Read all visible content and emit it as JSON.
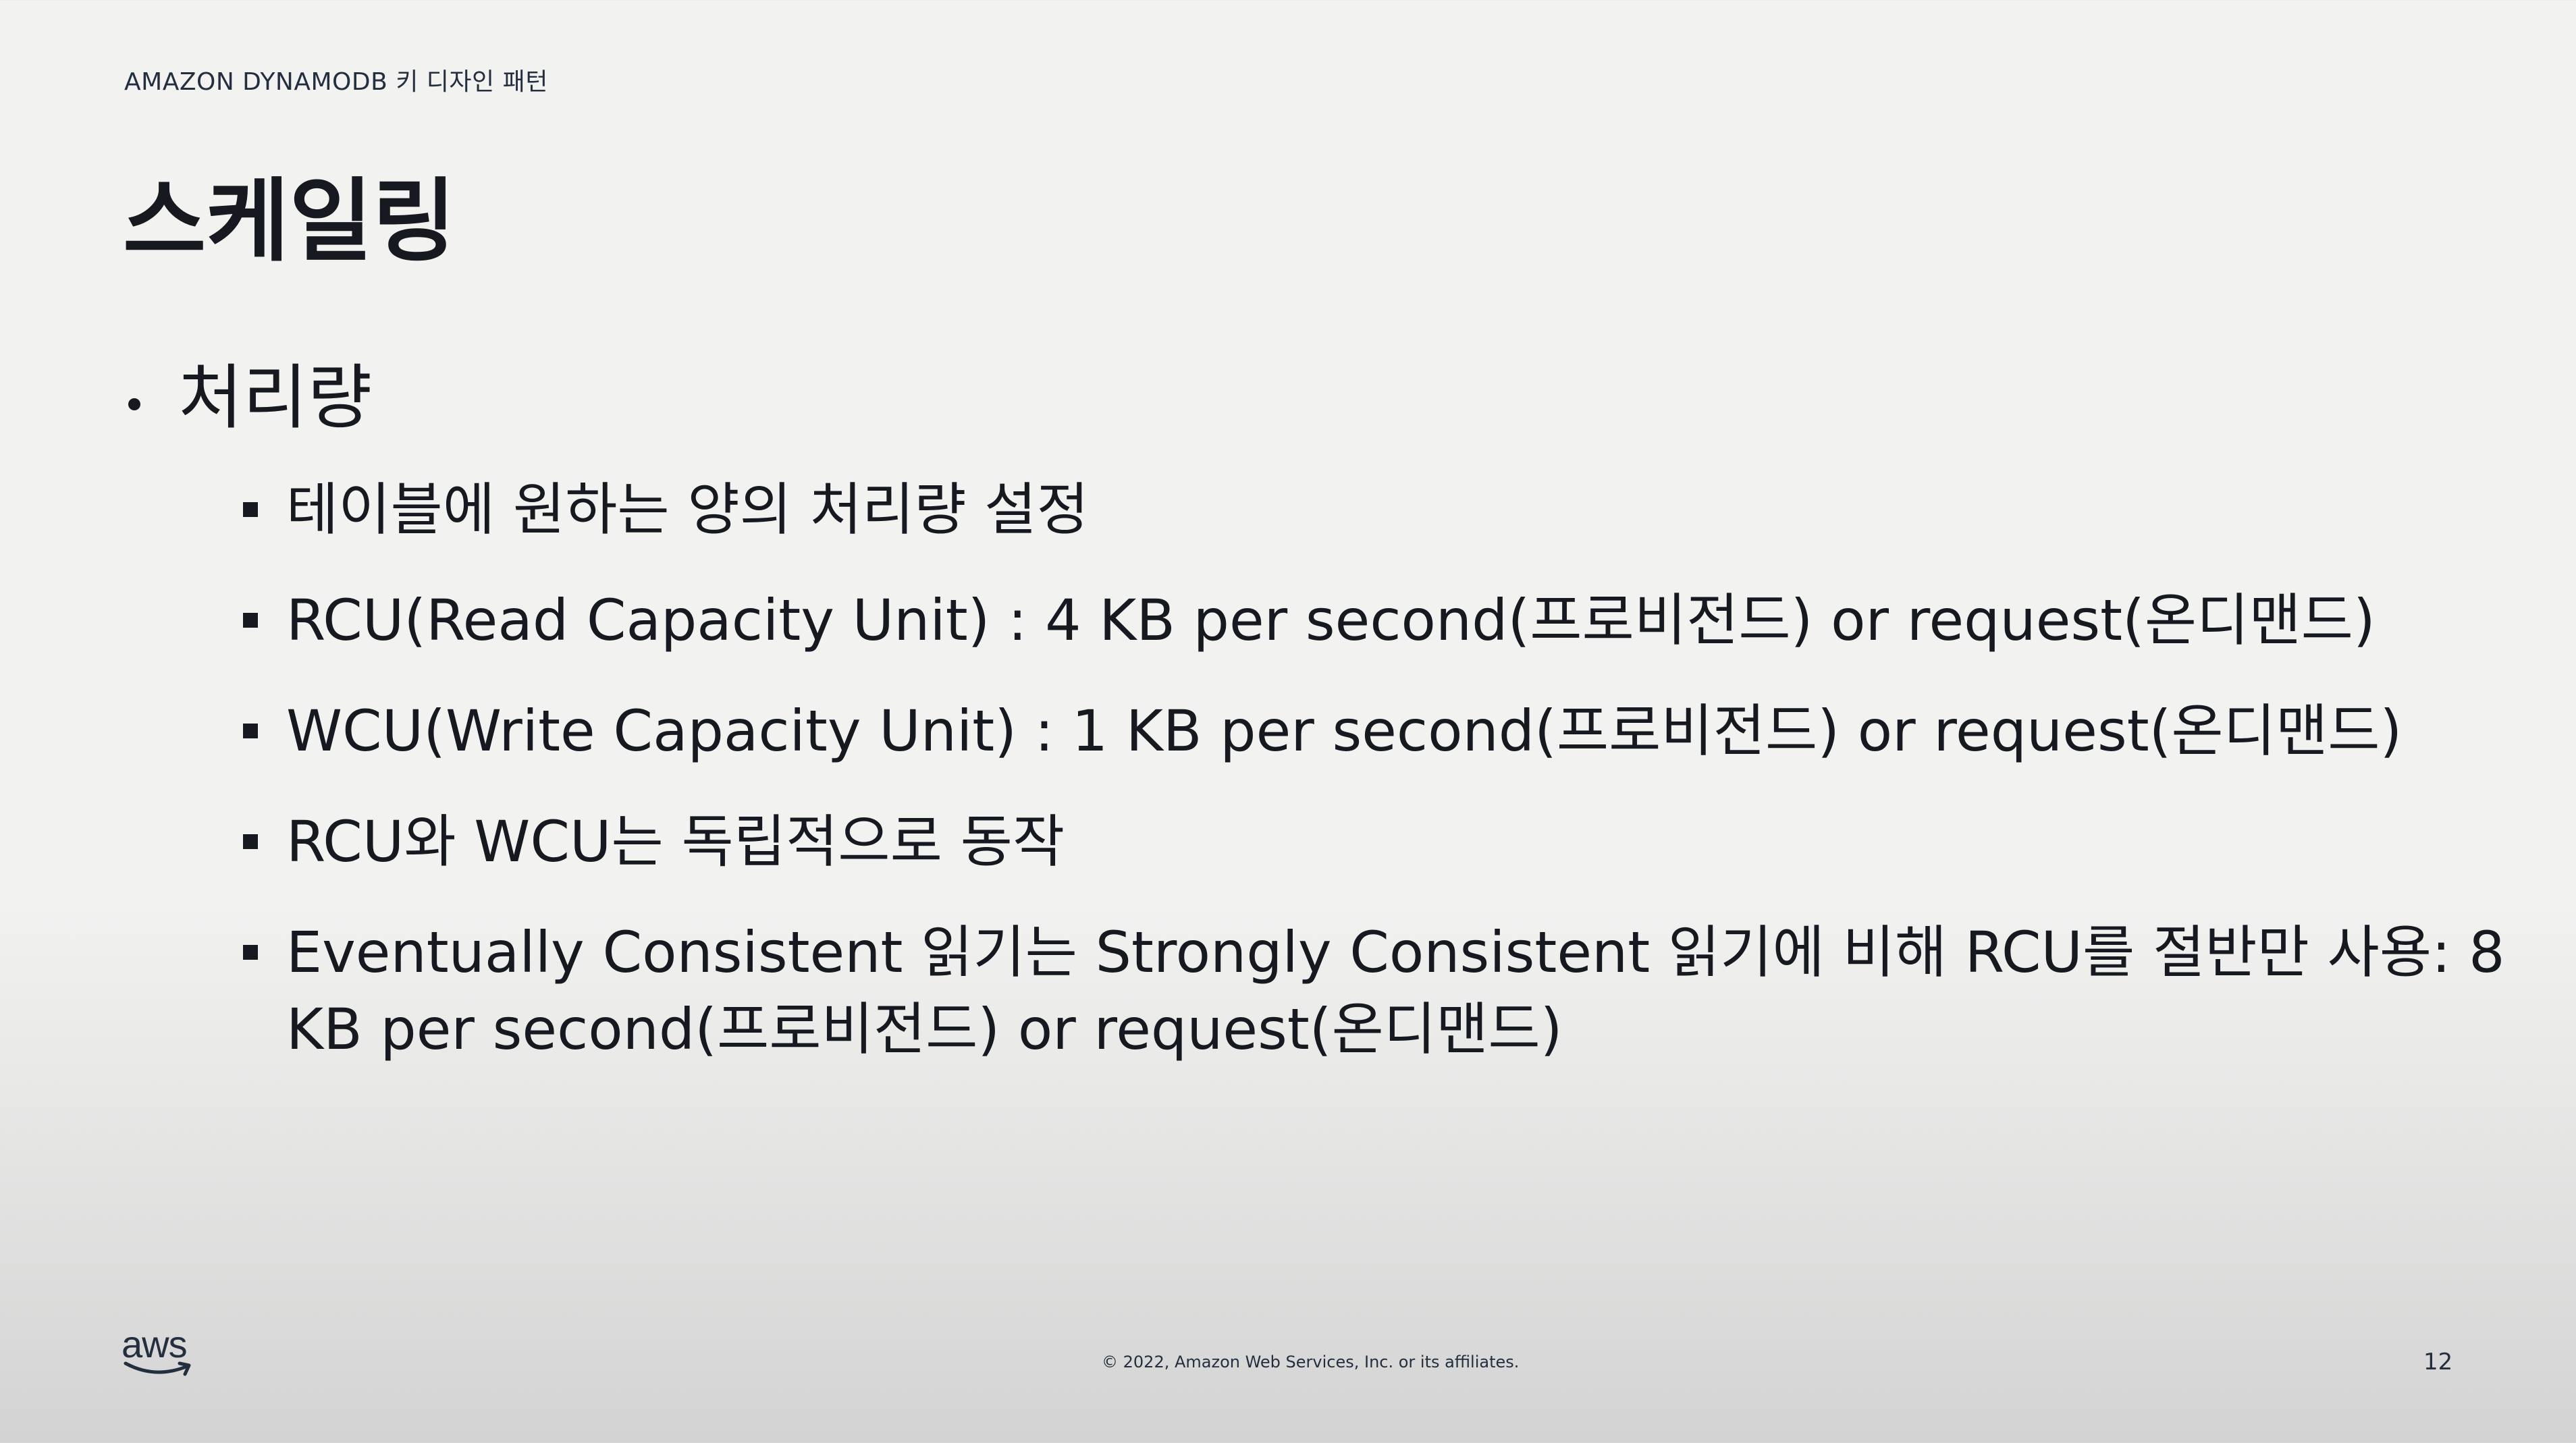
{
  "header": {
    "eyebrow": "AMAZON DYNAMODB 키 디자인 패턴"
  },
  "slide": {
    "title": "스케일링",
    "bullet": {
      "label": "처리량",
      "items": [
        "테이블에 원하는 양의 처리량 설정",
        "RCU(Read Capacity Unit) : 4 KB per second(프로비전드) or request(온디맨드)",
        "WCU(Write Capacity Unit) : 1 KB per second(프로비전드) or request(온디맨드)",
        "RCU와 WCU는 독립적으로 동작",
        "Eventually Consistent 읽기는 Strongly Consistent 읽기에 비해 RCU를 절반만 사용: 8 KB per second(프로비전드) or request(온디맨드)"
      ]
    }
  },
  "footer": {
    "logo_text": "aws",
    "copyright": "© 2022, Amazon Web Services, Inc. or its affiliates.",
    "page_number": "12"
  },
  "colors": {
    "text": "#16191f",
    "brand_dark": "#232f3e",
    "background": "#f2f2f1"
  }
}
